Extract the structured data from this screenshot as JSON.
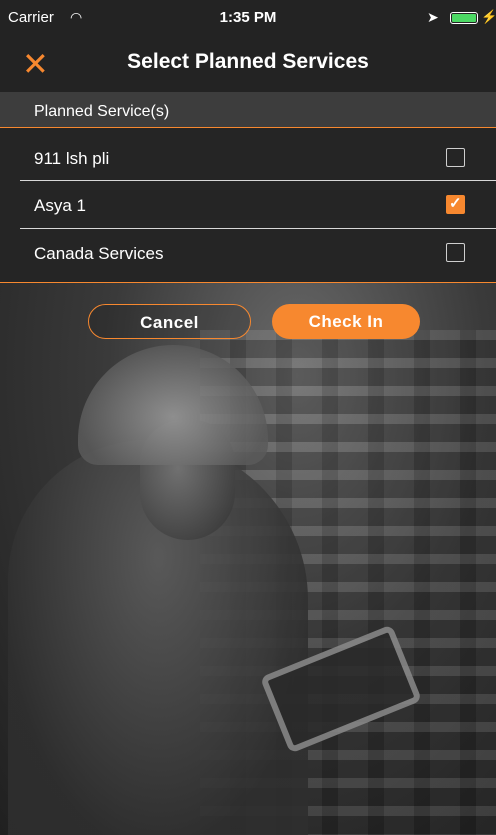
{
  "status_bar": {
    "carrier": "Carrier",
    "time": "1:35 PM"
  },
  "nav": {
    "title": "Select Planned Services",
    "close_icon": "close-icon"
  },
  "section": {
    "title": "Planned Service(s)"
  },
  "services": [
    {
      "label": "911 lsh pli",
      "checked": false
    },
    {
      "label": "Asya 1",
      "checked": true
    },
    {
      "label": "Canada Services",
      "checked": false
    }
  ],
  "buttons": {
    "cancel": "Cancel",
    "check_in": "Check In"
  },
  "colors": {
    "accent": "#f7882f",
    "panel": "#252525",
    "header": "#3d3d3d"
  }
}
